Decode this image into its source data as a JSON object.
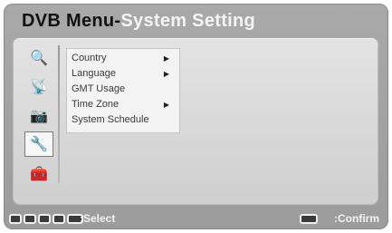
{
  "window": {
    "title_prefix": "DVB Menu-",
    "title_suffix": "System Setting"
  },
  "sidebar": {
    "icons": [
      {
        "name": "search-icon",
        "glyph": "🔍",
        "selected": false
      },
      {
        "name": "satellite-dish-icon",
        "glyph": "📡",
        "selected": false
      },
      {
        "name": "camera-icon",
        "glyph": "📷",
        "selected": false
      },
      {
        "name": "tools-icon",
        "glyph": "🔧",
        "selected": true
      },
      {
        "name": "toolbox-icon",
        "glyph": "🧰",
        "selected": false
      }
    ]
  },
  "submenu": {
    "items": [
      {
        "label": "Country",
        "has_submenu": true
      },
      {
        "label": "Language",
        "has_submenu": true
      },
      {
        "label": "GMT Usage",
        "has_submenu": false
      },
      {
        "label": "Time Zone",
        "has_submenu": true
      },
      {
        "label": "System Schedule",
        "has_submenu": false
      }
    ]
  },
  "footer": {
    "select_label": ":Select",
    "confirm_label": ":Confirm"
  },
  "colors": {
    "background": "#a6a6a6",
    "panel": "#d9d9d9",
    "submenu": "#f3f3f3",
    "title_accent": "#f4f4f4"
  }
}
